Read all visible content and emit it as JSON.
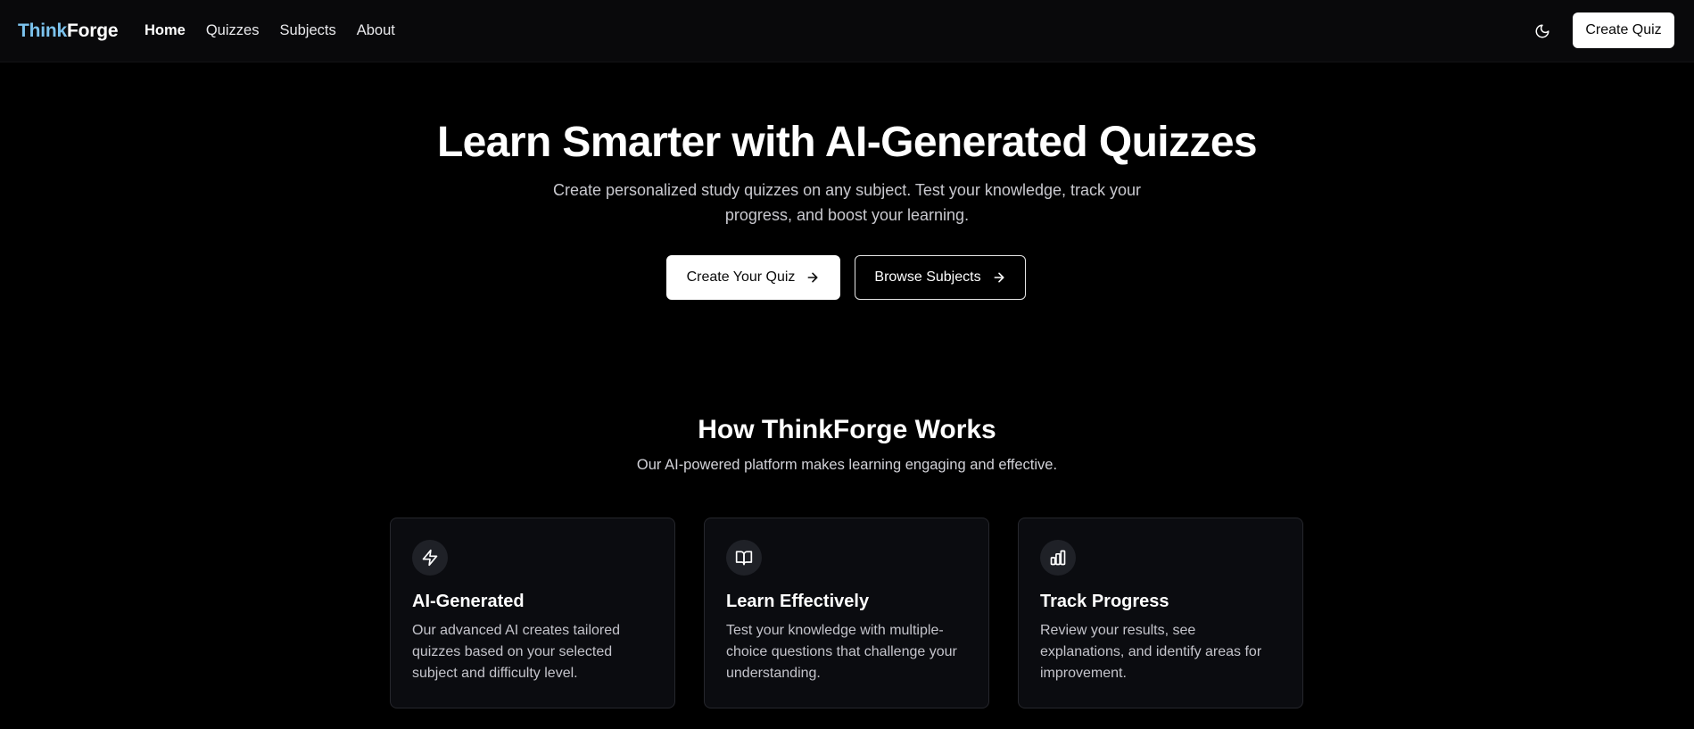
{
  "nav": {
    "logo_part1": "Think",
    "logo_part2": "Forge",
    "links": [
      {
        "label": "Home",
        "active": true
      },
      {
        "label": "Quizzes",
        "active": false
      },
      {
        "label": "Subjects",
        "active": false
      },
      {
        "label": "About",
        "active": false
      }
    ],
    "theme_toggle_icon": "moon-icon",
    "create_button": "Create Quiz"
  },
  "hero": {
    "title": "Learn Smarter with AI-Generated Quizzes",
    "subtitle": "Create personalized study quizzes on any subject. Test your knowledge, track your progress, and boost your learning.",
    "primary_button": "Create Your Quiz",
    "secondary_button": "Browse Subjects",
    "button_icon": "arrow-right-icon"
  },
  "features": {
    "title": "How ThinkForge Works",
    "subtitle": "Our AI-powered platform makes learning engaging and effective.",
    "cards": [
      {
        "icon": "lightning-icon",
        "title": "AI-Generated",
        "text": "Our advanced AI creates tailored quizzes based on your selected subject and difficulty level."
      },
      {
        "icon": "book-open-icon",
        "title": "Learn Effectively",
        "text": "Test your knowledge with multiple-choice questions that challenge your understanding."
      },
      {
        "icon": "bar-chart-icon",
        "title": "Track Progress",
        "text": "Review your results, see explanations, and identify areas for improvement."
      }
    ]
  },
  "colors": {
    "background": "#000000",
    "navbar": "#09090b",
    "logo_accent": "#7cc3ee",
    "card_background": "#0b0c10",
    "card_border": "#26272d",
    "icon_circle": "#1f2127"
  }
}
